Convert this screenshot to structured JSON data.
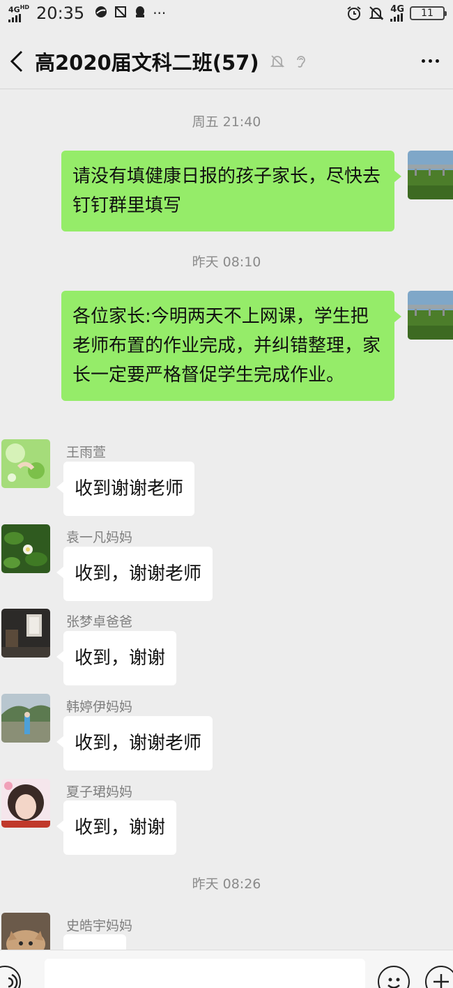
{
  "status_bar": {
    "network": "4G",
    "network_sup": "HD",
    "time": "20:35",
    "network_right": "4G",
    "battery": "11"
  },
  "header": {
    "title": "高2020届文科二班(57)",
    "icons": [
      "back-icon",
      "mute-bell-icon",
      "earpiece-icon",
      "more-icon"
    ]
  },
  "messages": {
    "ts1": "周五 21:40",
    "out1": "请没有填健康日报的孩子家长，尽快去钉钉群里填写",
    "ts2": "昨天 08:10",
    "out2": "各位家长:今明两天不上网课，学生把老师布置的作业完成，并纠错整理，家长一定要严格督促学生完成作业。",
    "m1_sender": "王雨萱",
    "m1_text": "收到谢谢老师",
    "m2_sender": "袁一凡妈妈",
    "m2_text": "收到，谢谢老师",
    "m3_sender": "张梦卓爸爸",
    "m3_text": "收到，谢谢",
    "m4_sender": "韩婷伊妈妈",
    "m4_text": "收到，谢谢老师",
    "m5_sender": "夏子珺妈妈",
    "m5_text": "收到，谢谢",
    "ts3": "昨天 08:26",
    "m6_sender": "史皓宇妈妈"
  },
  "colors": {
    "outgoing_bubble": "#95ec69",
    "incoming_bubble": "#ffffff",
    "background": "#ededed"
  }
}
